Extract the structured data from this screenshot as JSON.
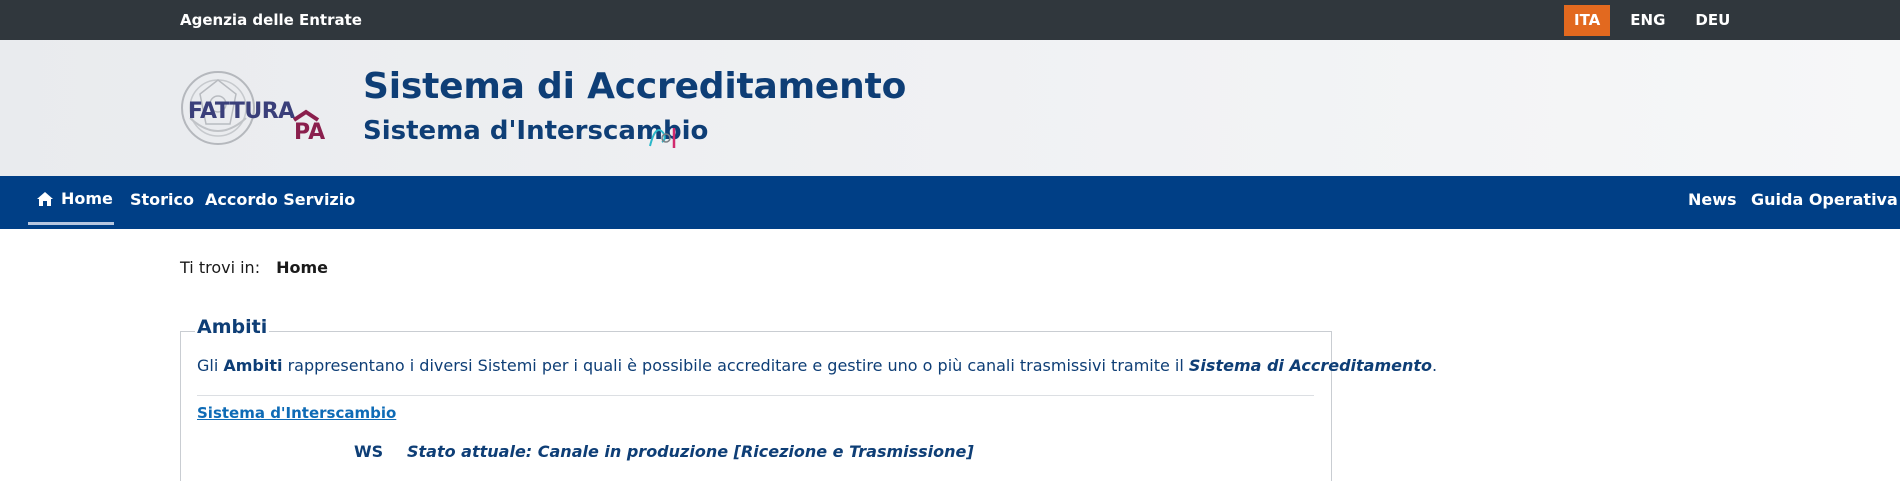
{
  "topbar": {
    "agency": "Agenzia delle Entrate",
    "languages": [
      {
        "label": "ITA",
        "active": true
      },
      {
        "label": "ENG",
        "active": false
      },
      {
        "label": "DEU",
        "active": false
      }
    ],
    "accent_color": "#e2691f"
  },
  "header": {
    "logo_alt": "FatturaPA",
    "logo_text_main": "FATTURA",
    "logo_text_pa": "PA",
    "title": "Sistema di Accreditamento",
    "subtitle": "Sistema d'Interscambio",
    "sdi_icon": "sdi-logo-icon"
  },
  "navbar": {
    "home": "Home",
    "storico": "Storico",
    "accordo": "Accordo Servizio",
    "news": "News",
    "guida": "Guida Operativa",
    "home_icon": "home-icon",
    "bg_color": "#003f86"
  },
  "breadcrumb": {
    "prefix": "Ti trovi in:",
    "current": "Home"
  },
  "ambiti": {
    "legend": "Ambiti",
    "desc_part1": "Gli ",
    "desc_bold": "Ambiti",
    "desc_part2": " rappresentano i diversi Sistemi per i quali è possibile accreditare e gestire uno o più canali trasmissivi tramite il ",
    "desc_italic": "Sistema di Accreditamento",
    "desc_part3": ".",
    "link_sdi": "Sistema d'Interscambio",
    "ws_label": "WS",
    "ws_status": "Stato attuale: Canale in produzione [Ricezione e Trasmissione]"
  }
}
